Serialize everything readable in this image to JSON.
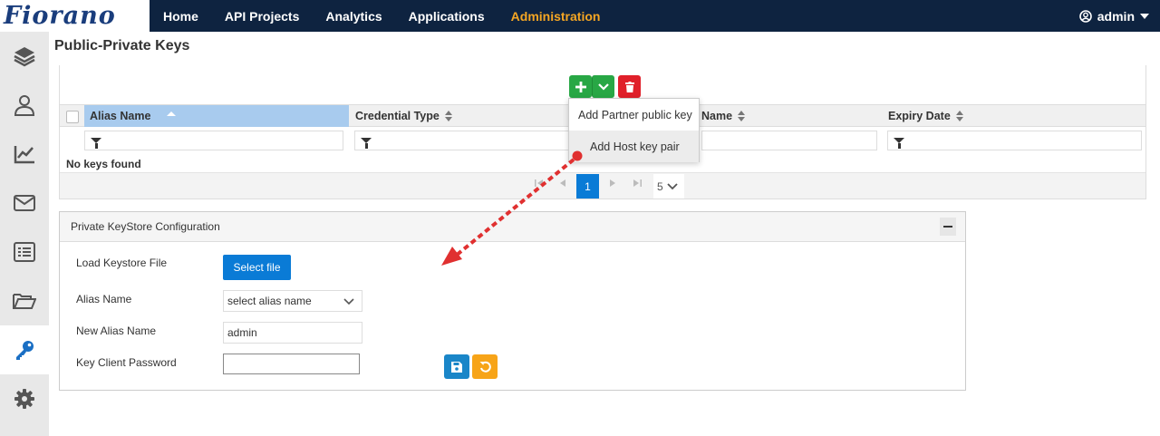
{
  "app": {
    "logo_text": "Fiorano"
  },
  "nav": {
    "items": [
      {
        "label": "Home"
      },
      {
        "label": "API Projects"
      },
      {
        "label": "Analytics"
      },
      {
        "label": "Applications"
      },
      {
        "label": "Administration",
        "active": true
      }
    ],
    "user": "admin"
  },
  "sidebar": {
    "items": [
      {
        "icon": "layers-icon"
      },
      {
        "icon": "user-icon"
      },
      {
        "icon": "chart-icon"
      },
      {
        "icon": "mail-icon"
      },
      {
        "icon": "list-icon"
      },
      {
        "icon": "folder-icon"
      },
      {
        "icon": "key-icon",
        "active": true
      },
      {
        "icon": "gear-icon"
      }
    ]
  },
  "page": {
    "title": "Public-Private Keys"
  },
  "grid": {
    "columns": [
      {
        "label": "Alias Name",
        "sorted": "asc"
      },
      {
        "label": "Credential Type"
      },
      {
        "label": "Name"
      },
      {
        "label": "Expiry Date"
      }
    ],
    "empty_message": "No keys found",
    "pager": {
      "current_page": "1",
      "page_size": "5"
    }
  },
  "add_menu": {
    "items": [
      {
        "label": "Add Partner public key"
      },
      {
        "label": "Add Host key pair",
        "hovered": true
      }
    ]
  },
  "keystore": {
    "title": "Private KeyStore Configuration",
    "load_label": "Load Keystore File",
    "select_file_button": "Select file",
    "alias_label": "Alias Name",
    "alias_select_value": "select alias name",
    "new_alias_label": "New Alias Name",
    "new_alias_value": "admin",
    "password_label": "Key Client Password",
    "password_value": ""
  },
  "colors": {
    "topbar": "#0e2340",
    "active_nav": "#f5a623",
    "primary": "#0a7bd6",
    "add_green": "#28a745",
    "delete_red": "#e0202a",
    "save_blue": "#1a86c8",
    "reset_orange": "#f7a418",
    "annotation": "#e03030"
  }
}
